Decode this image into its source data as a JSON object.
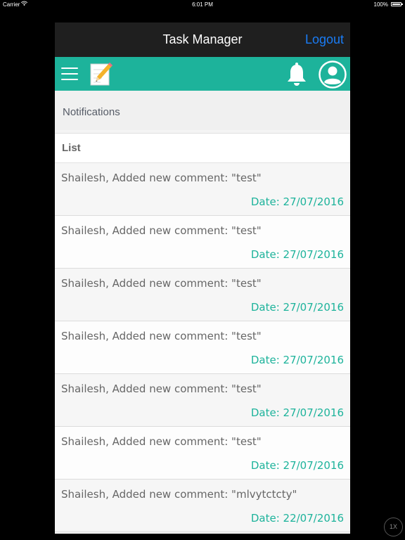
{
  "status_bar": {
    "carrier": "Carrier",
    "time": "6:01 PM",
    "battery": "100%"
  },
  "nav": {
    "title": "Task Manager",
    "logout_label": "Logout"
  },
  "toolbar": {
    "icons": [
      "menu-icon",
      "edit-note-icon",
      "bell-icon",
      "user-avatar-icon"
    ],
    "accent_color": "#1db39b"
  },
  "section": {
    "title": "Notifications"
  },
  "list": {
    "header": "List",
    "items": [
      {
        "message": "Shailesh, Added new comment: \"test\"",
        "date": "Date: 27/07/2016"
      },
      {
        "message": "Shailesh, Added new comment: \"test\"",
        "date": "Date: 27/07/2016"
      },
      {
        "message": "Shailesh, Added new comment: \"test\"",
        "date": "Date: 27/07/2016"
      },
      {
        "message": "Shailesh, Added new comment: \"test\"",
        "date": "Date: 27/07/2016"
      },
      {
        "message": "Shailesh, Added new comment: \"test\"",
        "date": "Date: 27/07/2016"
      },
      {
        "message": "Shailesh, Added new comment: \"test\"",
        "date": "Date: 27/07/2016"
      },
      {
        "message": "Shailesh, Added new comment: \"mlvytctcty\"",
        "date": "Date: 22/07/2016"
      }
    ]
  },
  "zoom_badge": "1X"
}
